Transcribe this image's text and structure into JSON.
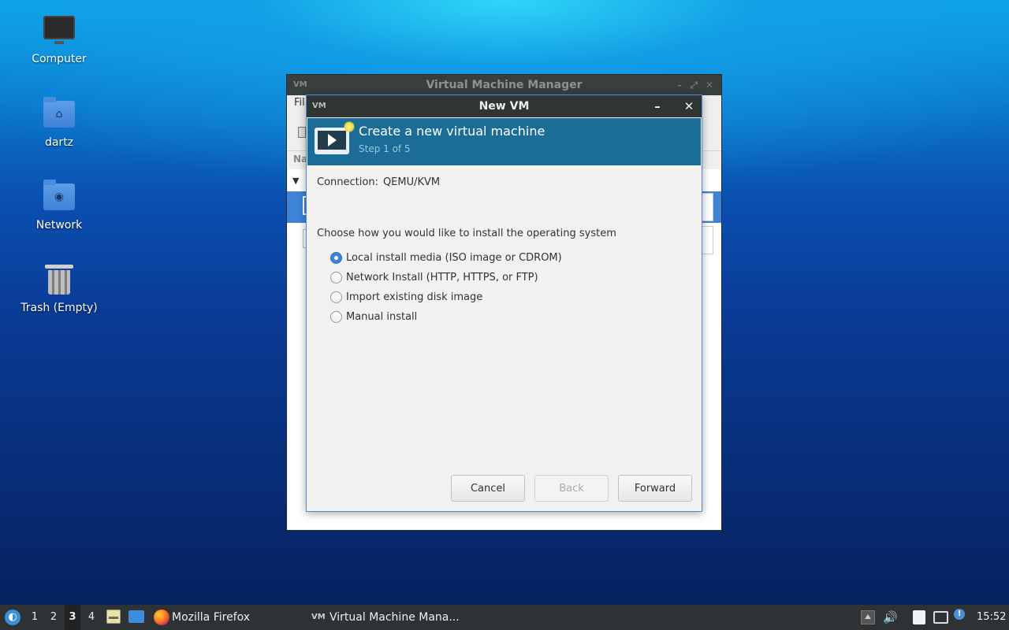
{
  "desktop": {
    "icons": [
      {
        "label": "Computer",
        "icon": "computer-icon"
      },
      {
        "label": "dartz",
        "icon": "home-folder-icon"
      },
      {
        "label": "Network",
        "icon": "network-folder-icon"
      },
      {
        "label": "Trash (Empty)",
        "icon": "trash-icon"
      }
    ]
  },
  "bg_window": {
    "title": "Virtual Machine Manager",
    "menu_partial": "Fil",
    "column_partial": "Na"
  },
  "dialog": {
    "title": "New VM",
    "banner_title": "Create a new virtual machine",
    "banner_step": "Step 1 of 5",
    "connection_label": "Connection:",
    "connection_value": "QEMU/KVM",
    "choose_label": "Choose how you would like to install the operating system",
    "options": [
      {
        "label": "Local install media (ISO image or CDROM)",
        "checked": true
      },
      {
        "label": "Network Install (HTTP, HTTPS, or FTP)",
        "checked": false
      },
      {
        "label": "Import existing disk image",
        "checked": false
      },
      {
        "label": "Manual install",
        "checked": false
      }
    ],
    "buttons": {
      "cancel": "Cancel",
      "back": "Back",
      "forward": "Forward"
    }
  },
  "taskbar": {
    "workspaces": [
      "1",
      "2",
      "3",
      "4"
    ],
    "active_workspace": "3",
    "tasks": [
      {
        "label": "Mozilla Firefox",
        "icon": "firefox-icon"
      },
      {
        "label": "Virtual Machine Mana...",
        "icon": "virt-manager-icon"
      }
    ],
    "clock": "15:52"
  },
  "colors": {
    "banner": "#1b6d98",
    "selection": "#3d84d8",
    "taskbar": "#2f3234",
    "titlebar": "#2f3435"
  }
}
